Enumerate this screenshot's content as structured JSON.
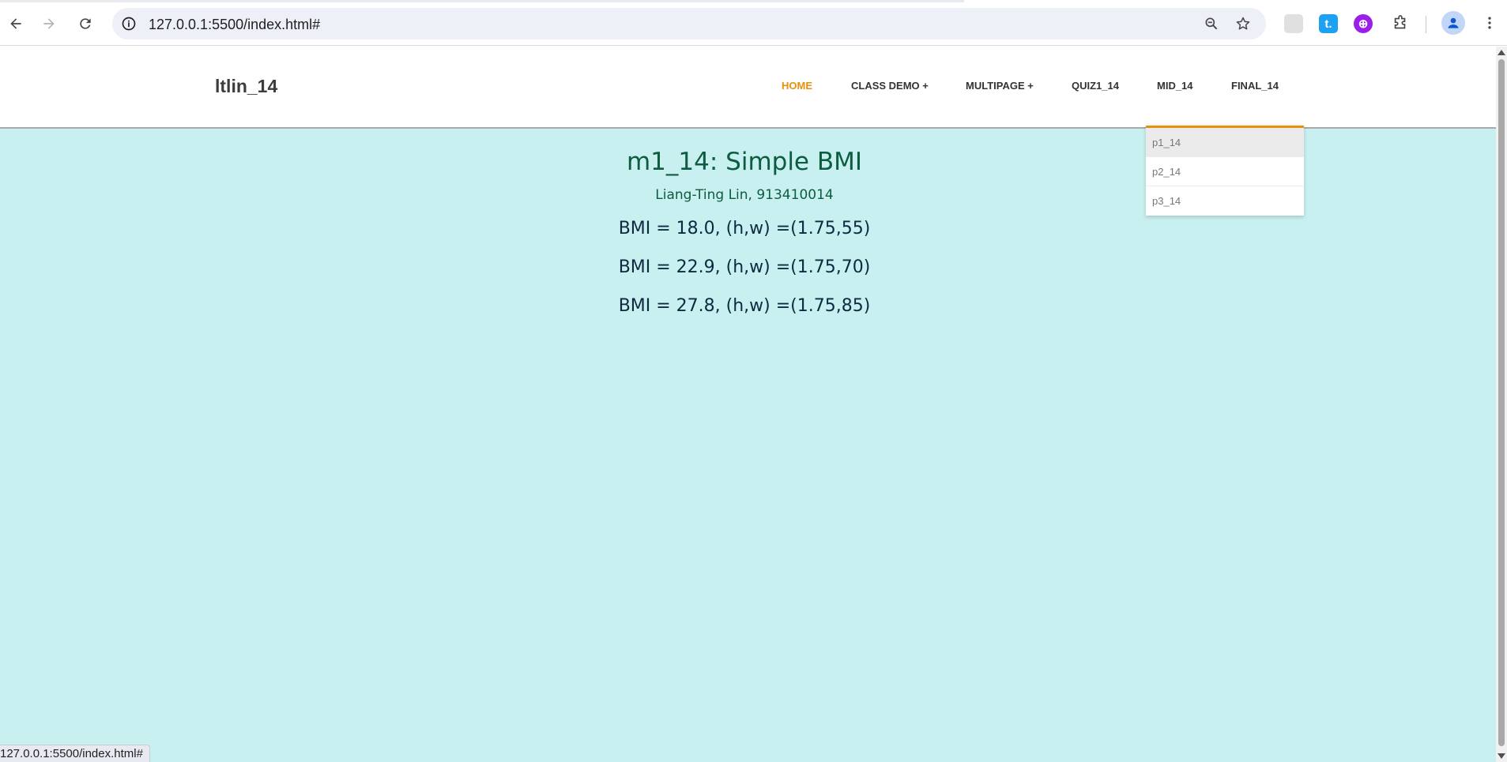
{
  "browser": {
    "url": "127.0.0.1:5500/index.html#",
    "status_url": "127.0.0.1:5500/index.html#",
    "extensions": [
      {
        "name": "blank-extension-icon",
        "label": "",
        "color": "#d7d7d7"
      },
      {
        "name": "t-extension-icon",
        "label": "t.",
        "color": "#1da1f2"
      },
      {
        "name": "purple-extension-icon",
        "label": "⊕",
        "color": "#9b1fe8"
      }
    ]
  },
  "site": {
    "logo": "ltlin_14",
    "nav": [
      {
        "label": "HOME",
        "active": true
      },
      {
        "label": "CLASS DEMO +",
        "active": false
      },
      {
        "label": "MULTIPAGE +",
        "active": false
      },
      {
        "label": "QUIZ1_14",
        "active": false
      },
      {
        "label": "MID_14",
        "active": false
      },
      {
        "label": "FINAL_14",
        "active": false
      }
    ],
    "dropdown": {
      "items": [
        "p1_14",
        "p2_14",
        "p3_14"
      ],
      "hovered_index": 0
    }
  },
  "content": {
    "title": "m1_14: Simple BMI",
    "author": "Liang-Ting Lin, 913410014",
    "results": [
      "BMI = 18.0, (h,w) =(1.75,55)",
      "BMI = 22.9, (h,w) =(1.75,70)",
      "BMI = 27.8, (h,w) =(1.75,85)"
    ]
  },
  "colors": {
    "accent": "#e8900c",
    "page_background": "#c9f0f0",
    "title_color": "#0d5c3f"
  }
}
